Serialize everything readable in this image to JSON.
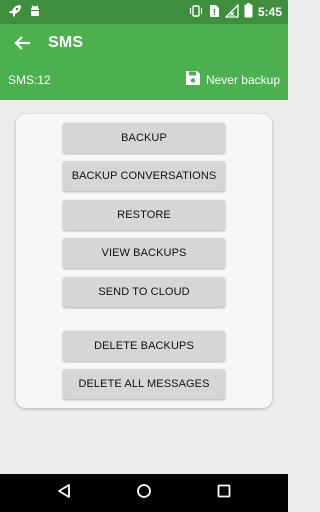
{
  "status_bar": {
    "time": "5:45",
    "icons": [
      "rocket-icon",
      "android-icon",
      "vibrate-icon",
      "no-sim-icon",
      "signal-icon",
      "battery-icon"
    ]
  },
  "app_bar": {
    "title": "SMS",
    "count_label": "SMS:12",
    "backup_status": "Never backup",
    "color": "#4caf50",
    "status_color": "#3e8e3d"
  },
  "buttons": {
    "backup": "BACKUP",
    "backup_conversations": "BACKUP CONVERSATIONS",
    "restore": "RESTORE",
    "view_backups": "VIEW BACKUPS",
    "send_to_cloud": "SEND TO CLOUD",
    "delete_backups": "DELETE BACKUPS",
    "delete_all_messages": "DELETE ALL MESSAGES"
  },
  "nav_bar": {
    "icons": [
      "back-triangle-icon",
      "home-circle-icon",
      "recents-square-icon"
    ]
  }
}
